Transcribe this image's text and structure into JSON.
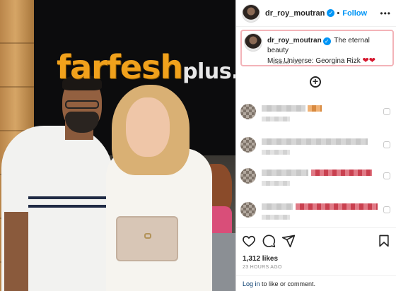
{
  "watermark": {
    "brand": "farfesh",
    "suffix": "plus.com"
  },
  "post": {
    "username": "dr_roy_moutran",
    "verified_glyph": "✓",
    "dot": "•",
    "follow_label": "Follow",
    "more_glyph": "•••",
    "caption_line1": "The eternal beauty",
    "caption_line2": "Miss Universe: Georgina Rizk",
    "hearts": "❤❤",
    "edited": "Edited · 23h",
    "add_glyph": "+",
    "likes": "1,312 likes",
    "timestamp": "23 HOURS AGO"
  },
  "footer": {
    "login_link": "Log in",
    "suffix_text": " to like or comment."
  },
  "icons": {
    "like": "heart-icon",
    "comment": "comment-icon",
    "share": "share-icon",
    "save": "bookmark-icon"
  },
  "colors": {
    "accent": "#0095f6",
    "highlight_border": "#f3b3b8",
    "watermark_orange": "#f0a11c",
    "heart_red": "#d6182f"
  }
}
